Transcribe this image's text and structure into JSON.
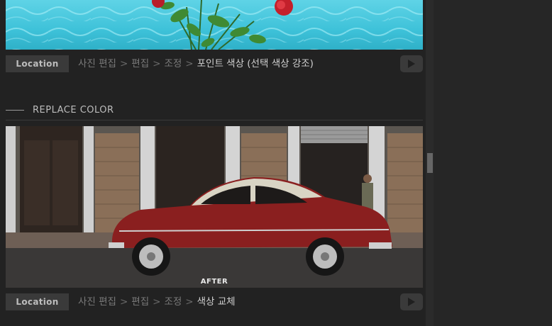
{
  "sections": [
    {
      "location_label": "Location",
      "breadcrumb": [
        "사진 편집",
        "편집",
        "조정",
        "포인트 색상 (선택 색상 강조)"
      ]
    },
    {
      "heading": "REPLACE COLOR",
      "image_caption": "AFTER",
      "location_label": "Location",
      "breadcrumb": [
        "사진 편집",
        "편집",
        "조정",
        "색상 교체"
      ]
    }
  ],
  "colors": {
    "background": "#222222",
    "car_red": "#8a1f1f"
  }
}
